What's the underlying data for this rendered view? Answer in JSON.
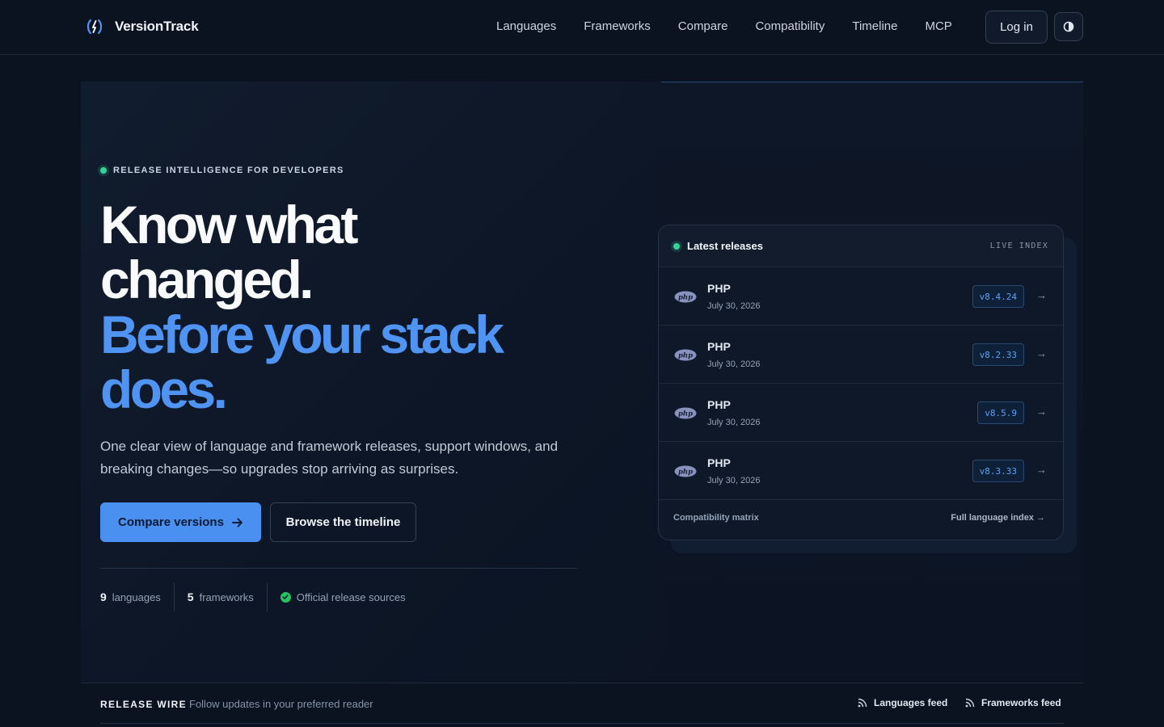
{
  "brand": {
    "name": "VersionTrack",
    "accent": "#4f94f3"
  },
  "nav": {
    "links": [
      "Languages",
      "Frameworks",
      "Compare",
      "Compatibility",
      "Timeline",
      "MCP"
    ],
    "login_label": "Log in",
    "theme_icon": "contrast-icon"
  },
  "hero": {
    "eyebrow": "RELEASE INTELLIGENCE FOR DEVELOPERS",
    "headline": {
      "line1": "Know what",
      "line2": "changed.",
      "line3": "Before your stack",
      "line4": "does."
    },
    "subtitle": "One clear view of language and framework releases, support windows, and breaking changes—so upgrades stop arriving as surprises.",
    "primary_cta": "Compare versions",
    "secondary_cta": "Browse the timeline",
    "stats": {
      "languages_count": "9",
      "languages_label": "languages",
      "frameworks_count": "5",
      "frameworks_label": "frameworks",
      "sources_label": "Official release sources"
    }
  },
  "releases_card": {
    "title": "Latest releases",
    "badge": "LIVE INDEX",
    "rows": [
      {
        "name": "PHP",
        "date": "July 30, 2026",
        "version": "v8.4.24"
      },
      {
        "name": "PHP",
        "date": "July 30, 2026",
        "version": "v8.2.33"
      },
      {
        "name": "PHP",
        "date": "July 30, 2026",
        "version": "v8.5.9"
      },
      {
        "name": "PHP",
        "date": "July 30, 2026",
        "version": "v8.3.33"
      }
    ],
    "footer_left": "Compatibility matrix",
    "footer_right": "Full language index →"
  },
  "release_wire": {
    "title": "RELEASE WIRE",
    "subtitle": "Follow updates in your preferred reader",
    "languages_feed": "Languages feed",
    "frameworks_feed": "Frameworks feed"
  }
}
